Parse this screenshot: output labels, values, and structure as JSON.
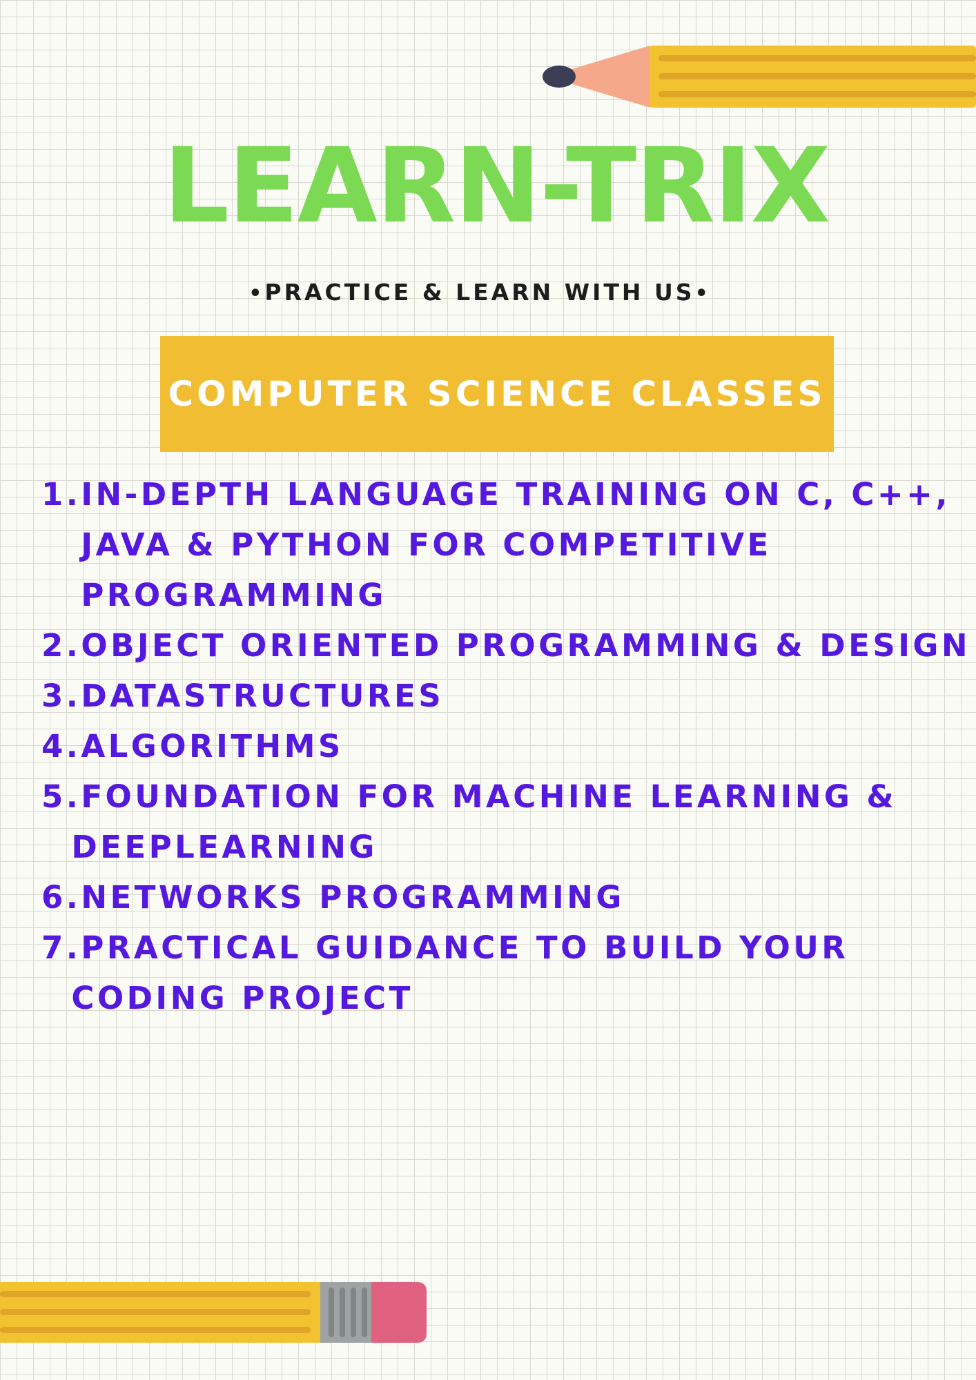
{
  "header": {
    "title": "LEARN-TRIX",
    "tagline": "PRACTICE & LEARN WITH US",
    "tagline_bullet": "•"
  },
  "banner": {
    "label": "COMPUTER SCIENCE CLASSES"
  },
  "courses": [
    {
      "num": "1.",
      "lines": [
        "IN-DEPTH LANGUAGE TRAINING ON C, C++,",
        "JAVA & PYTHON FOR COMPETITIVE",
        "PROGRAMMING"
      ]
    },
    {
      "num": "2.",
      "lines": [
        "OBJECT ORIENTED PROGRAMMING & DESIGN"
      ]
    },
    {
      "num": "3.",
      "lines": [
        "DATASTRUCTURES"
      ]
    },
    {
      "num": "4.",
      "lines": [
        "ALGORITHMS"
      ]
    },
    {
      "num": "5.",
      "lines": [
        "FOUNDATION FOR MACHINE LEARNING &",
        "DEEPLEARNING"
      ]
    },
    {
      "num": "6.",
      "lines": [
        "NETWORKS PROGRAMMING"
      ]
    },
    {
      "num": "7.",
      "lines": [
        "PRACTICAL GUIDANCE TO BUILD YOUR",
        "CODING PROJECT"
      ]
    }
  ],
  "colors": {
    "title_green": "#7bd954",
    "banner_yellow": "#f1be33",
    "list_purple": "#5518de",
    "pencil_yellow": "#f2c230",
    "pencil_stripe": "#e0a428",
    "pencil_wood": "#f6a98a",
    "pencil_lead": "#3b3e54",
    "eraser_pink": "#e06080",
    "ferrule_gray": "#9ea3a3"
  },
  "icons": {
    "top": "pencil-icon",
    "bottom": "pencil-icon"
  }
}
